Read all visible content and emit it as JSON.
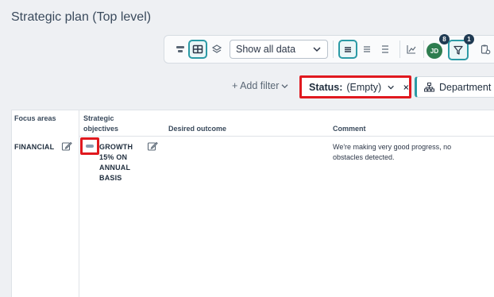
{
  "page": {
    "title": "Strategic plan (Top level)"
  },
  "toolbar": {
    "view_select": {
      "value": "Show all data"
    },
    "avatar": {
      "initials": "JD",
      "badge": "8"
    },
    "filter_badge": "1"
  },
  "filters": {
    "add_filter_label": "+ Add filter",
    "status_chip": {
      "label": "Status:",
      "value": "(Empty)"
    },
    "department_chip": {
      "label": "Department"
    }
  },
  "table": {
    "headers": {
      "focus_areas": "Focus areas",
      "strategic_objectives": "Strategic objectives",
      "desired_outcome": "Desired outcome",
      "comment": "Comment"
    },
    "rows": [
      {
        "focus_area": "FINANCIAL",
        "objective": "GROWTH 15% ON ANNUAL BASIS",
        "desired_outcome": "",
        "comment": "We're making very good progress, no obstacles detected."
      }
    ]
  },
  "colors": {
    "accent": "#2b9aa5",
    "highlight": "#e0191f",
    "avatar": "#2e7d4f",
    "badge": "#1f3a52"
  }
}
